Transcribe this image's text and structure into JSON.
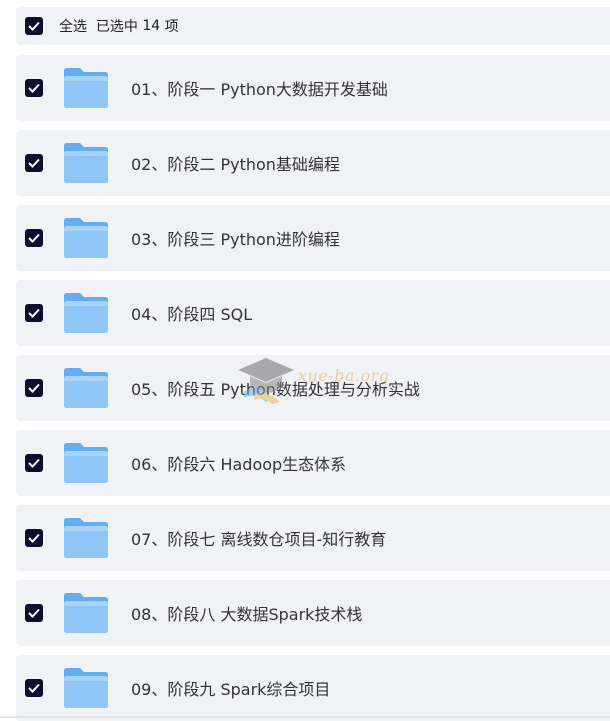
{
  "header": {
    "select_all_label": "全选  已选中 ",
    "selected_count": "14",
    "count_unit": " 项"
  },
  "files": [
    {
      "name": "01、阶段一 Python大数据开发基础",
      "checked": true,
      "icon": "folder-icon"
    },
    {
      "name": "02、阶段二 Python基础编程",
      "checked": true,
      "icon": "folder-icon"
    },
    {
      "name": "03、阶段三 Python进阶编程",
      "checked": true,
      "icon": "folder-icon"
    },
    {
      "name": "04、阶段四 SQL",
      "checked": true,
      "icon": "folder-icon"
    },
    {
      "name": "05、阶段五 Python数据处理与分析实战",
      "checked": true,
      "icon": "folder-icon"
    },
    {
      "name": "06、阶段六 Hadoop生态体系",
      "checked": true,
      "icon": "folder-icon"
    },
    {
      "name": "07、阶段七 离线数仓项目-知行教育",
      "checked": true,
      "icon": "folder-icon"
    },
    {
      "name": "08、阶段八 大数据Spark技术栈",
      "checked": true,
      "icon": "folder-icon"
    },
    {
      "name": "09、阶段九 Spark综合项目",
      "checked": true,
      "icon": "folder-icon"
    }
  ],
  "watermark": {
    "text": "xue-ba.org"
  },
  "colors": {
    "checkbox_fill": "#0f0c2e",
    "row_background": "#f1f2f5",
    "folder_front": "#8fc6f7",
    "folder_back": "#63aef0"
  }
}
